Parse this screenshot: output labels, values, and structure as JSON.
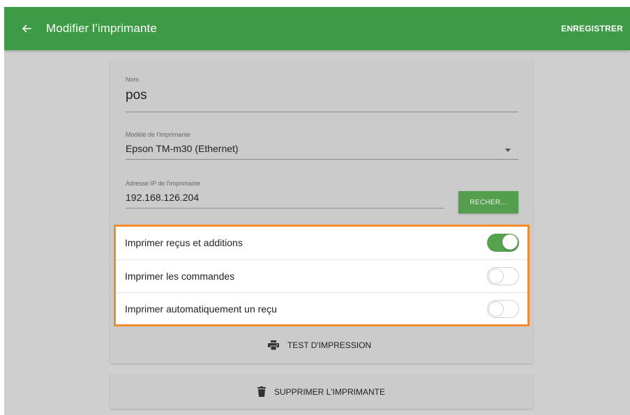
{
  "appbar": {
    "title": "Modifier l’imprimante",
    "save_label": "ENREGISTRER",
    "back_icon": "arrow-left-icon",
    "color": "#3d9a45"
  },
  "form": {
    "name": {
      "label": "Nom",
      "value": "pos"
    },
    "model": {
      "label": "Modèle de l'imprimante",
      "value": "Epson TM-m30 (Ethernet)"
    },
    "ip": {
      "label": "Adresse IP de l'imprimante",
      "value": "192.168.126.204",
      "scan_label": "RECHER..."
    }
  },
  "toggles": [
    {
      "label": "Imprimer reçus et additions",
      "on": true
    },
    {
      "label": "Imprimer les commandes",
      "on": false
    },
    {
      "label": "Imprimer automatiquement un reçu",
      "on": false
    }
  ],
  "actions": {
    "test_print": {
      "label": "TEST D'IMPRESSION",
      "icon": "printer-icon"
    },
    "delete": {
      "label": "SUPPRIMER L'IMPRIMANTE",
      "icon": "trash-icon"
    }
  },
  "colors": {
    "accent": "#55a34c",
    "highlight": "#f08a2c"
  }
}
